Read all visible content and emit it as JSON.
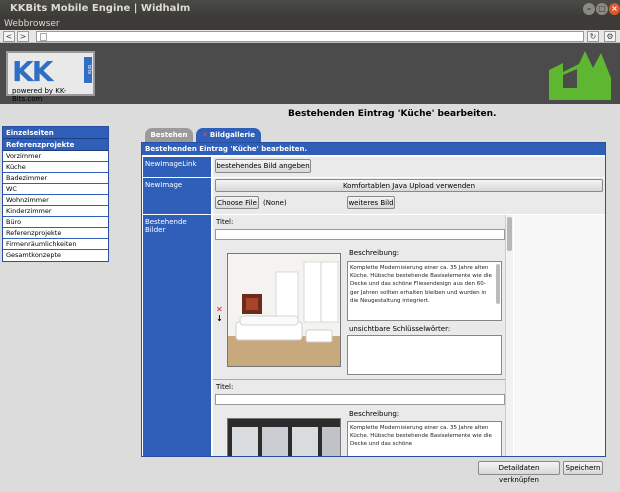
{
  "window": {
    "title": "KKBits Mobile Engine | Widhalm",
    "app_name": "Webbrowser"
  },
  "toolbar": {
    "back": "<",
    "forward": ">",
    "reload": "↻",
    "settings": "⚙"
  },
  "logo": {
    "kk": "KK",
    "bits": "bits",
    "powered": "powered by KK-Bits.com"
  },
  "sidebar": {
    "header1": "Einzelseiten",
    "header2": "Referenzprojekte",
    "items": [
      "Vorzimmer",
      "Küche",
      "Badezimmer",
      "WC",
      "Wohnzimmer",
      "Kinderzimmer",
      "Büro",
      "Referenzprojekte",
      "Firmenräumlichkeiten",
      "Gesamtkonzepte"
    ]
  },
  "main": {
    "title": "Bestehenden Eintrag 'Küche' bearbeiten.",
    "tabs": [
      {
        "label": "Bestehen"
      },
      {
        "label": "Bildgallerie",
        "close": "✕"
      }
    ],
    "panel_header": "Bestehenden Eintrag 'Küche' bearbeiten.",
    "newimagelink": {
      "label": "NewImageLink",
      "button": "bestehendes Bild angeben"
    },
    "newimage": {
      "label": "NewImage",
      "java_button": "Komfortablen Java Upload verwenden",
      "choose_file": "Choose File",
      "none": "(None)",
      "more_button": "weiteres Bild"
    },
    "existing": {
      "label": "Bestehende Bilder",
      "entries": [
        {
          "title_label": "Titel:",
          "title_value": "",
          "desc_label": "Beschreibung:",
          "desc_text": "Komplette Modernisierung einer ca. 35 Jahre alten Küche. Hübsche bestehende Basiselemente wie die Decke und das schöne Fliesendesign aus den 60-ger Jahren sollten erhalten bleiben und wurden in die Neugestaltung integriert.",
          "keywords_label": "unsichtbare Schlüsselwörter:",
          "keywords_value": ""
        },
        {
          "title_label": "Titel:",
          "title_value": "",
          "desc_label": "Beschreibung:",
          "desc_text": "Komplette Modernisierung einer ca. 35 Jahre alten Küche. Hübsche bestehende Basiselemente wie die Decke und das schöne"
        }
      ]
    }
  },
  "footer": {
    "link_button": "Detaildaten verknüpfen",
    "save_button": "Speichern"
  },
  "colors": {
    "accent": "#2f5fb8",
    "header_bg": "#4b4b4b",
    "logo_green": "#5fb630"
  }
}
